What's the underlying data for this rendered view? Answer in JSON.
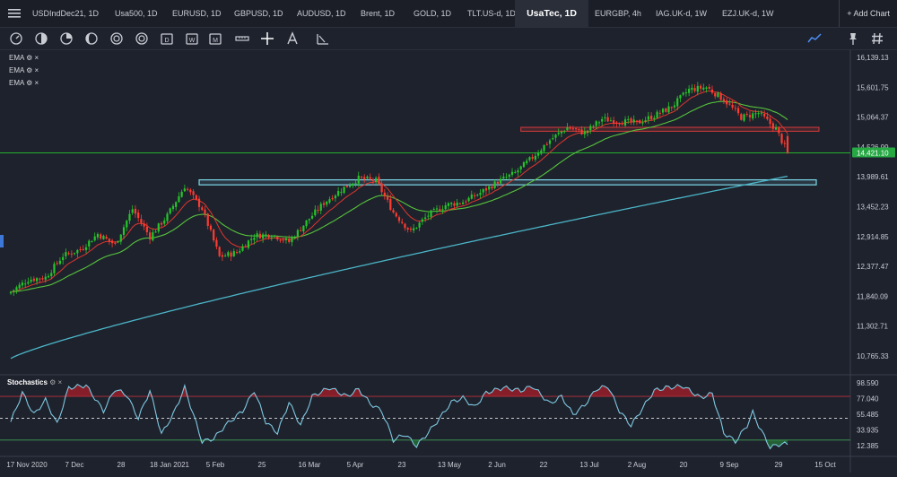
{
  "tabs": [
    {
      "label": "USDIndDec21, 1D",
      "left": 36,
      "width": 80
    },
    {
      "label": "Usa500, 1D",
      "left": 128,
      "width": 50
    },
    {
      "label": "EURUSD, 1D",
      "left": 192,
      "width": 55
    },
    {
      "label": "GBPUSD, 1D",
      "left": 261,
      "width": 55
    },
    {
      "label": "AUDUSD, 1D",
      "left": 331,
      "width": 55
    },
    {
      "label": "Brent, 1D",
      "left": 402,
      "width": 45
    },
    {
      "label": "GOLD, 1D",
      "left": 461,
      "width": 45
    },
    {
      "label": "TLT.US-d, 1D",
      "left": 521,
      "width": 60
    },
    {
      "label": "UsaTec, 1D",
      "left": 584,
      "width": 62,
      "active": true
    },
    {
      "label": "EURGBP, 4h",
      "left": 663,
      "width": 55
    },
    {
      "label": "IAG.UK-d, 1W",
      "left": 731,
      "width": 60
    },
    {
      "label": "EZJ.UK-d, 1W",
      "left": 805,
      "width": 60
    }
  ],
  "add_chart": "+ Add Chart",
  "toolbar_icons": [
    "circle-tool-icon",
    "circle-half-icon",
    "circle-quarter-icon",
    "moon-icon",
    "target-icon",
    "target-icon",
    "calendar-icon",
    "calendar-w-icon",
    "calendar-m-icon",
    "measure-icon",
    "crosshair-icon",
    "text-tool-icon",
    "fib-tool-icon"
  ],
  "toolbar_right_icons": [
    "line-style-icon",
    "pin-icon",
    "hash-icon"
  ],
  "indicators": [
    {
      "name": "EMA"
    },
    {
      "name": "EMA"
    },
    {
      "name": "EMA"
    }
  ],
  "stoch_label": "Stochastics",
  "last_price": "14,421.10",
  "colors": {
    "up": "#26c42b",
    "down": "#ff3b30",
    "ema_fast": "#e0362d",
    "ema_mid": "#56c43c",
    "ema_slow": "#4bb6c8",
    "last_price_bg": "#26a843",
    "box_resist": "#d63b3b",
    "box_support": "#7dd8e8"
  },
  "chart_data": {
    "type": "candlestick",
    "x_tick_labels": [
      "17 Nov 2020",
      "7 Dec",
      "28",
      "18 Jan 2021",
      "5 Feb",
      "25",
      "16 Mar",
      "5 Apr",
      "23",
      "13 May",
      "2 Jun",
      "22",
      "13 Jul",
      "2 Aug",
      "20",
      "9 Sep",
      "29",
      "15 Oct"
    ],
    "y_tick_labels": [
      "16,139.13",
      "15,601.75",
      "15,064.37",
      "14,526.99",
      "13,989.61",
      "13,452.23",
      "12,914.85",
      "12,377.47",
      "11,840.09",
      "11,302.71",
      "10,765.33"
    ],
    "y_values": [
      16139.13,
      15601.75,
      15064.37,
      14526.99,
      13989.61,
      13452.23,
      12914.85,
      12377.47,
      11840.09,
      11302.71,
      10765.33
    ],
    "ylim": [
      10600,
      16250
    ],
    "last_price": 14421.1,
    "close_anchors": [
      [
        0,
        11920
      ],
      [
        6,
        12140
      ],
      [
        12,
        12180
      ],
      [
        18,
        12570
      ],
      [
        24,
        12680
      ],
      [
        30,
        12960
      ],
      [
        36,
        12770
      ],
      [
        42,
        13410
      ],
      [
        48,
        12910
      ],
      [
        54,
        13290
      ],
      [
        60,
        13820
      ],
      [
        66,
        13420
      ],
      [
        72,
        12550
      ],
      [
        78,
        12630
      ],
      [
        84,
        12930
      ],
      [
        90,
        12950
      ],
      [
        96,
        12820
      ],
      [
        102,
        13180
      ],
      [
        108,
        13520
      ],
      [
        114,
        13760
      ],
      [
        120,
        13960
      ],
      [
        126,
        13920
      ],
      [
        132,
        13350
      ],
      [
        138,
        13000
      ],
      [
        144,
        13300
      ],
      [
        150,
        13480
      ],
      [
        156,
        13540
      ],
      [
        162,
        13700
      ],
      [
        168,
        13900
      ],
      [
        174,
        14060
      ],
      [
        180,
        14340
      ],
      [
        186,
        14650
      ],
      [
        192,
        14880
      ],
      [
        198,
        14780
      ],
      [
        204,
        15030
      ],
      [
        210,
        14990
      ],
      [
        216,
        14960
      ],
      [
        222,
        15090
      ],
      [
        228,
        15250
      ],
      [
        234,
        15560
      ],
      [
        240,
        15600
      ],
      [
        246,
        15380
      ],
      [
        252,
        15060
      ],
      [
        258,
        15140
      ],
      [
        264,
        14850
      ],
      [
        268,
        14420
      ]
    ],
    "ema_series": [
      {
        "name": "EMA",
        "period": 10,
        "color": "#e0362d"
      },
      {
        "name": "EMA",
        "period": 30,
        "color": "#56c43c"
      },
      {
        "name": "EMA",
        "period": 200,
        "color": "#4bb6c8",
        "start": 10720
      }
    ],
    "horizontal_lines": [
      {
        "price": 14421.1,
        "color": "#26c42b"
      }
    ],
    "boxes": [
      {
        "from_index": -1,
        "price_top": 14880,
        "price_bottom": 14810,
        "color": "#d63b3b",
        "label": "resistance-box"
      },
      {
        "from_index": -2,
        "price_top": 13935,
        "price_bottom": 13845,
        "color": "#7dd8e8",
        "label": "support-box"
      }
    ],
    "stochastic": {
      "y_tick_labels": [
        "98.590",
        "77.040",
        "55.485",
        "33.935",
        "12.385"
      ],
      "y_values": [
        98.59,
        77.04,
        55.485,
        33.935,
        12.385
      ],
      "ylim": [
        5,
        100
      ],
      "levels": [
        80,
        50,
        20
      ],
      "k_anchors": [
        [
          0,
          45
        ],
        [
          4,
          85
        ],
        [
          8,
          55
        ],
        [
          12,
          75
        ],
        [
          16,
          42
        ],
        [
          20,
          92
        ],
        [
          26,
          95
        ],
        [
          32,
          60
        ],
        [
          36,
          90
        ],
        [
          40,
          82
        ],
        [
          44,
          50
        ],
        [
          48,
          88
        ],
        [
          52,
          28
        ],
        [
          56,
          55
        ],
        [
          60,
          92
        ],
        [
          66,
          18
        ],
        [
          70,
          22
        ],
        [
          74,
          40
        ],
        [
          80,
          60
        ],
        [
          84,
          88
        ],
        [
          88,
          45
        ],
        [
          92,
          30
        ],
        [
          96,
          72
        ],
        [
          100,
          40
        ],
        [
          104,
          80
        ],
        [
          110,
          92
        ],
        [
          116,
          80
        ],
        [
          120,
          90
        ],
        [
          124,
          70
        ],
        [
          128,
          60
        ],
        [
          132,
          20
        ],
        [
          136,
          28
        ],
        [
          140,
          12
        ],
        [
          144,
          30
        ],
        [
          148,
          50
        ],
        [
          152,
          72
        ],
        [
          156,
          78
        ],
        [
          160,
          65
        ],
        [
          164,
          85
        ],
        [
          170,
          92
        ],
        [
          176,
          88
        ],
        [
          180,
          94
        ],
        [
          186,
          70
        ],
        [
          190,
          80
        ],
        [
          194,
          55
        ],
        [
          198,
          68
        ],
        [
          202,
          90
        ],
        [
          206,
          94
        ],
        [
          210,
          60
        ],
        [
          214,
          40
        ],
        [
          218,
          64
        ],
        [
          222,
          88
        ],
        [
          226,
          92
        ],
        [
          232,
          94
        ],
        [
          238,
          78
        ],
        [
          242,
          84
        ],
        [
          246,
          30
        ],
        [
          250,
          18
        ],
        [
          254,
          40
        ],
        [
          256,
          58
        ],
        [
          258,
          40
        ],
        [
          262,
          10
        ],
        [
          266,
          15
        ],
        [
          268,
          14
        ]
      ]
    }
  }
}
